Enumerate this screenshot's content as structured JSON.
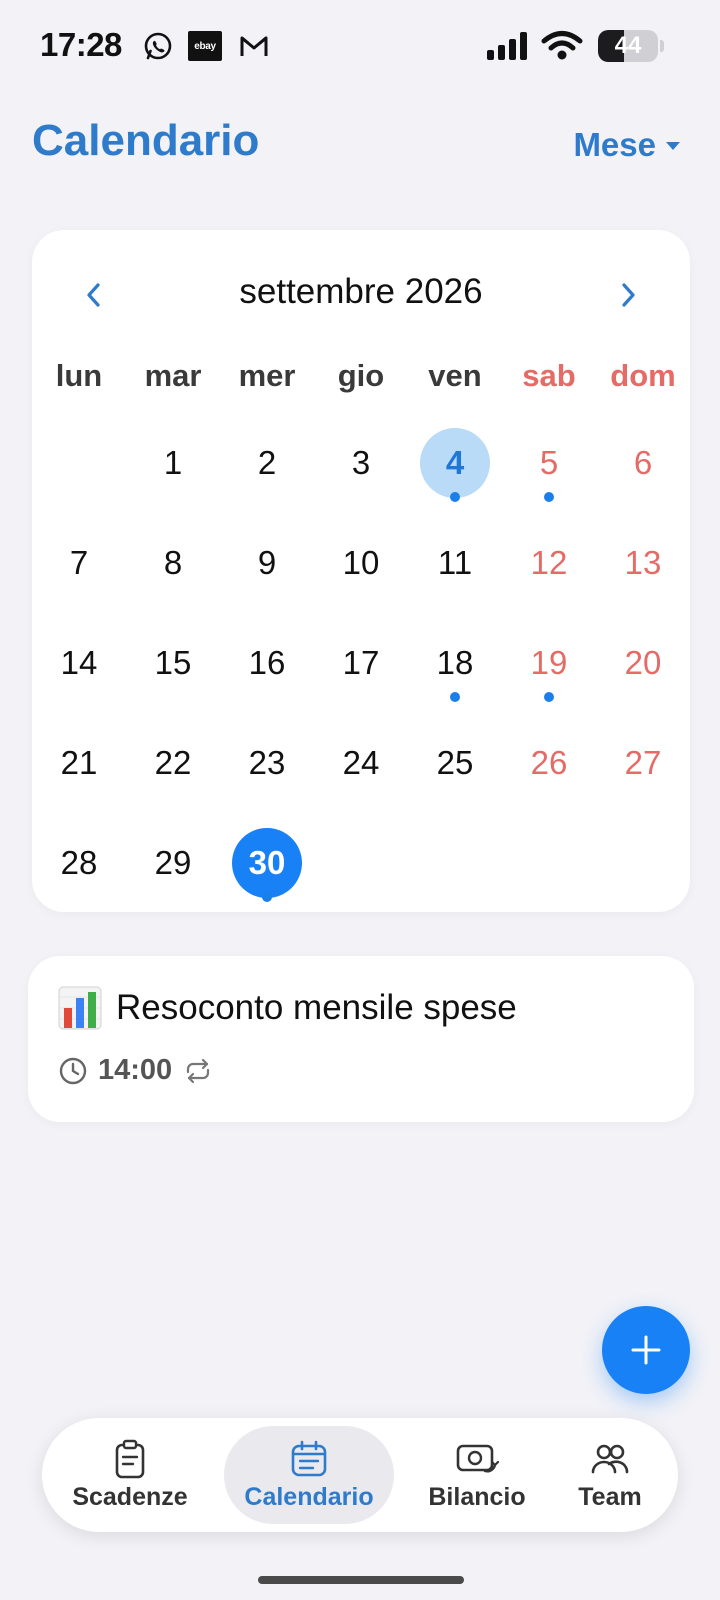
{
  "status_bar": {
    "time": "17:28",
    "app_icons": [
      "whatsapp-icon",
      "ebay-icon",
      "gmail-icon"
    ],
    "ebay_text": "ebay",
    "battery_level": 44,
    "battery_text": "44"
  },
  "header": {
    "title": "Calendario",
    "view_mode": "Mese"
  },
  "calendar": {
    "month_label": "settembre 2026",
    "weekdays": [
      "lun",
      "mar",
      "mer",
      "gio",
      "ven",
      "sab",
      "dom"
    ],
    "leading_blanks": 1,
    "days_in_month": 30,
    "today": 4,
    "selected": 30,
    "event_days": [
      4,
      5,
      18,
      19,
      30
    ],
    "weekend_color": "#E46B66",
    "accent_color": "#1781F5"
  },
  "event": {
    "icon": "bar-chart-emoji",
    "title": "Resoconto mensile spese",
    "time": "14:00",
    "repeat_icon": "repeat-icon"
  },
  "bottom_nav": {
    "items": [
      {
        "id": "scadenze",
        "label": "Scadenze",
        "icon": "clipboard-icon",
        "active": false
      },
      {
        "id": "calendario",
        "label": "Calendario",
        "icon": "calendar-icon",
        "active": true
      },
      {
        "id": "bilancio",
        "label": "Bilancio",
        "icon": "money-icon",
        "active": false
      },
      {
        "id": "team",
        "label": "Team",
        "icon": "team-icon",
        "active": false
      }
    ]
  },
  "fab": {
    "icon": "plus-icon"
  }
}
